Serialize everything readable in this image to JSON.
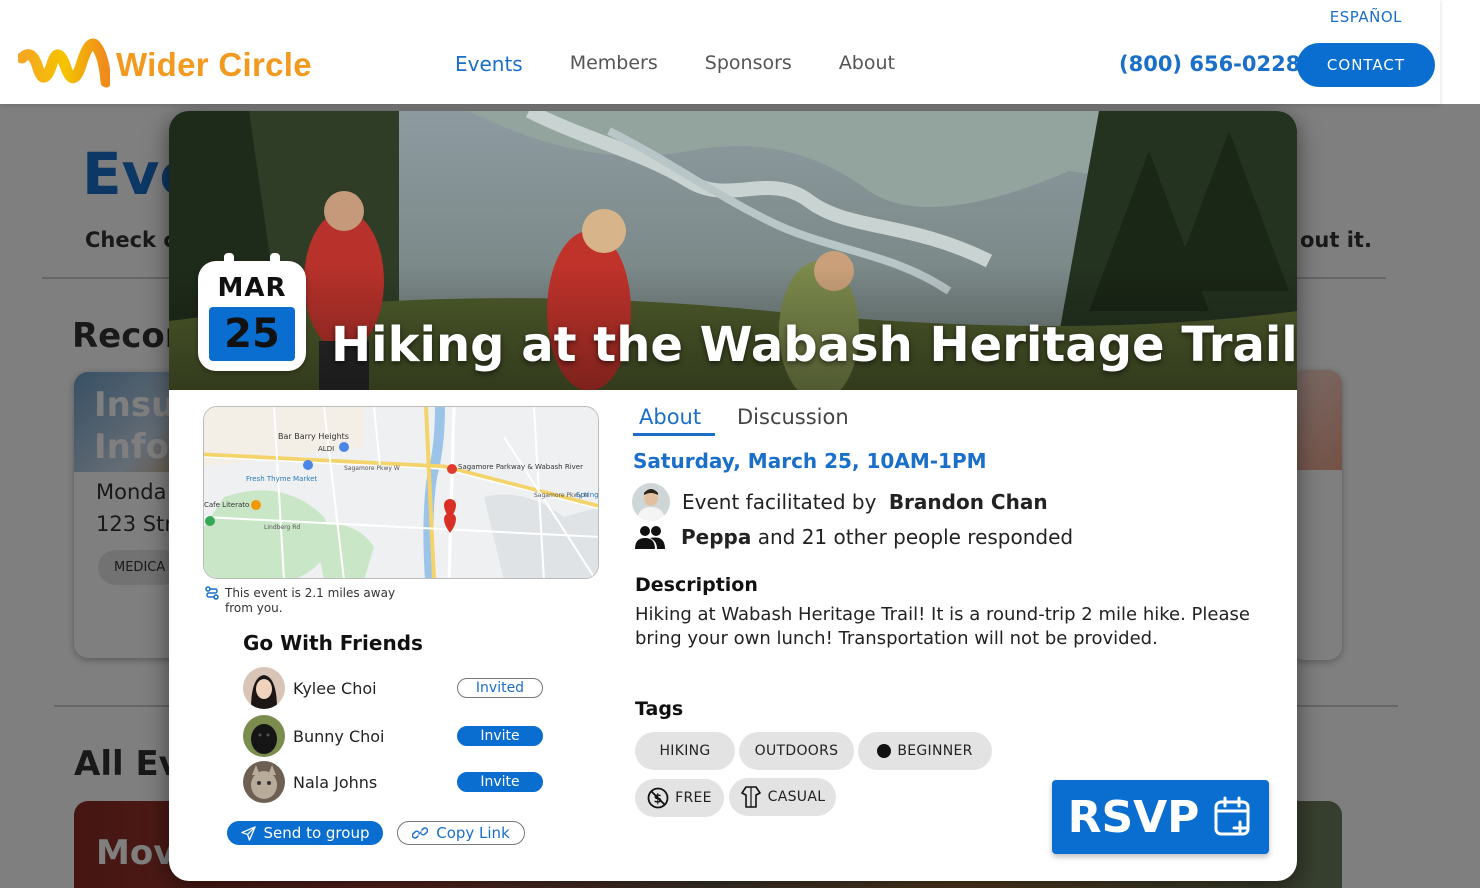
{
  "header": {
    "brand": "Wider Circle",
    "language_link": "ESPAÑOL",
    "nav": [
      "Events",
      "Members",
      "Sponsors",
      "About"
    ],
    "active_nav": "Events",
    "phone": "(800) 656-0228",
    "contact_label": "CONTACT"
  },
  "background_page": {
    "title_partial": "Eve",
    "subtitle_left_partial": "Check c",
    "subtitle_right_partial": "out it.",
    "recommended_partial": "Recor",
    "card1_title_lines": [
      "Insu",
      "Info"
    ],
    "card1_lines": [
      "Monda",
      "123 Stre"
    ],
    "card1_chip": "MEDICA",
    "all_events_partial": "All Ev",
    "card3_title_partial": "Mov"
  },
  "event": {
    "date_month": "MAR",
    "date_day": "25",
    "title": "Hiking at the Wabash Heritage Trail",
    "map_labels": {
      "area": "Bar Barry Heights",
      "store": "ALDI",
      "market": "Fresh Thyme Market",
      "cafe": "Cafe Literato",
      "destination": "Sagamore Parkway & Wabash River",
      "road1": "Sagamore Pkwy W",
      "road2": "Sagamore Pkwy N",
      "road3": "Lindberg Rd",
      "spring": "Spring"
    },
    "distance_text": "This event is 2.1 miles away from you.",
    "friends_title": "Go With Friends",
    "friends": [
      {
        "name": "Kylee Choi",
        "action": "Invited",
        "state": "invited"
      },
      {
        "name": "Bunny Choi",
        "action": "Invite",
        "state": "invite"
      },
      {
        "name": "Nala Johns",
        "action": "Invite",
        "state": "invite"
      }
    ],
    "send_to_group": "Send to group",
    "copy_link": "Copy Link",
    "tabs": [
      "About",
      "Discussion"
    ],
    "active_tab": "About",
    "when": "Saturday, March 25, 10AM-1PM",
    "facilitated_prefix": "Event facilitated by ",
    "facilitator": "Brandon Chan",
    "responder": "Peppa",
    "responded_suffix": " and 21 other people responded",
    "description_heading": "Description",
    "description": "Hiking at Wabash Heritage Trail! It is a round-trip 2 mile hike. Please bring your own lunch! Transportation will not be provided.",
    "tags_heading": "Tags",
    "tags": [
      "HIKING",
      "OUTDOORS",
      "BEGINNER",
      "FREE",
      "CASUAL"
    ],
    "rsvp_label": "RSVP"
  },
  "colors": {
    "primary": "#0a6ed1",
    "link": "#1a6fc9",
    "brand_orange": "#f39a1e",
    "tag_bg": "#e3e3e3"
  }
}
